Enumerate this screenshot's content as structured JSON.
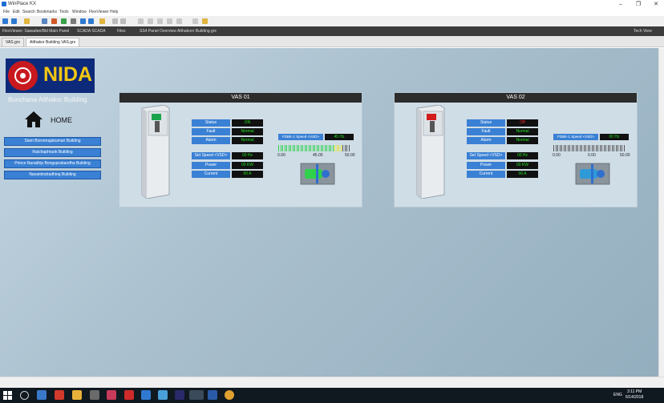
{
  "window": {
    "title": "WinPlace KX",
    "minimize": "–",
    "maximize": "❐",
    "close": "✕"
  },
  "menu": [
    "File",
    "Edit",
    "Search",
    "Bookmarks",
    "Tools",
    "Window",
    "FlexViewer",
    "Help"
  ],
  "favorites": [
    "FlexViewer: Sawadee/Bld Main Panel",
    "SCADA SCADA",
    "Files",
    "SS4 Panel Overview Atthakorn Building.grx"
  ],
  "favorites_right": "Tech View",
  "tabs": [
    "VAS.grx",
    "Atthakor Building VAS.grx"
  ],
  "logo": {
    "text": "NIDA"
  },
  "building_title": "Bunchana Atthakor Building",
  "home_label": "HOME",
  "buildings": [
    "Siam Boromrajakumari Building",
    "Ratchaphruek Building",
    "Prince Naradhip Bongsprabandha Building",
    "Navamindradhiraj Building"
  ],
  "labels": {
    "status": "Status",
    "fault": "Fault",
    "alarm": "Alarm",
    "set_speed": "Set Speed <VSD>",
    "power": "Power",
    "current": "Current",
    "fdbk": "FDBK-1 Speed <VSD>"
  },
  "panels": [
    {
      "title": "VAS 01",
      "status": "ON",
      "fault": "Normal",
      "alarm": "Normal",
      "set_speed": "00 Hz",
      "power": "00 KW",
      "current": "00 A",
      "feedback": "45 Hz",
      "bar_level": 0.9,
      "scale": [
        "0.00",
        "45.00",
        "50.00"
      ],
      "running": true
    },
    {
      "title": "VAS 02",
      "status": "Off",
      "fault": "Normal",
      "alarm": "Normal",
      "set_speed": "00 Hz",
      "power": "00 KW",
      "current": "00 A",
      "feedback": "00 Hz",
      "bar_level": 0.0,
      "scale": [
        "0.00",
        "0.00",
        "50.00"
      ],
      "running": false
    }
  ],
  "taskbar": {
    "time": "3:11 PM",
    "date": "6/14/2018",
    "lang": "ENG"
  }
}
